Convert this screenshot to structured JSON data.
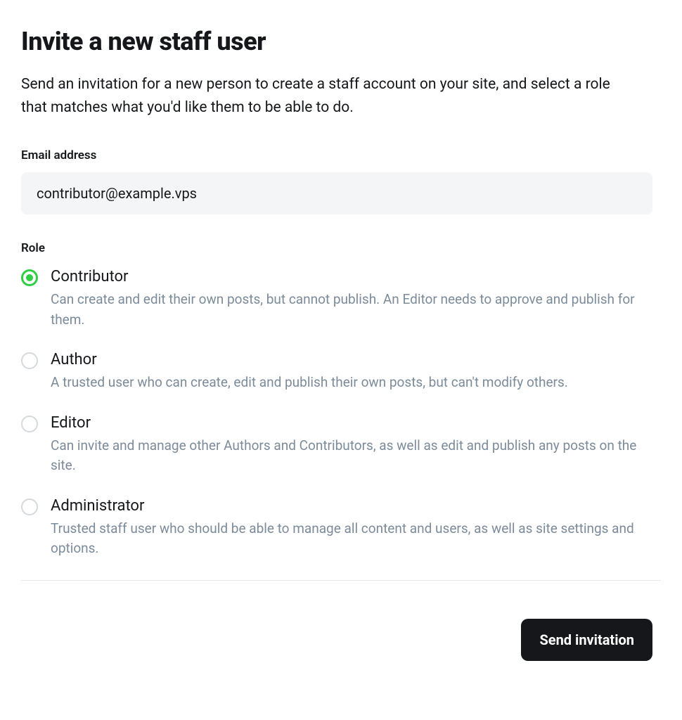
{
  "header": {
    "title": "Invite a new staff user",
    "description": "Send an invitation for a new person to create a staff account on your site, and select a role that matches what you'd like them to be able to do."
  },
  "emailField": {
    "label": "Email address",
    "value": "contributor@example.vps"
  },
  "roleField": {
    "label": "Role",
    "selectedIndex": 0,
    "options": [
      {
        "name": "Contributor",
        "description": "Can create and edit their own posts, but cannot publish. An Editor needs to approve and publish for them."
      },
      {
        "name": "Author",
        "description": "A trusted user who can create, edit and publish their own posts, but can't modify others."
      },
      {
        "name": "Editor",
        "description": "Can invite and manage other Authors and Contributors, as well as edit and publish any posts on the site."
      },
      {
        "name": "Administrator",
        "description": "Trusted staff user who should be able to manage all content and users, as well as site settings and options."
      }
    ]
  },
  "footer": {
    "sendButtonLabel": "Send invitation"
  }
}
